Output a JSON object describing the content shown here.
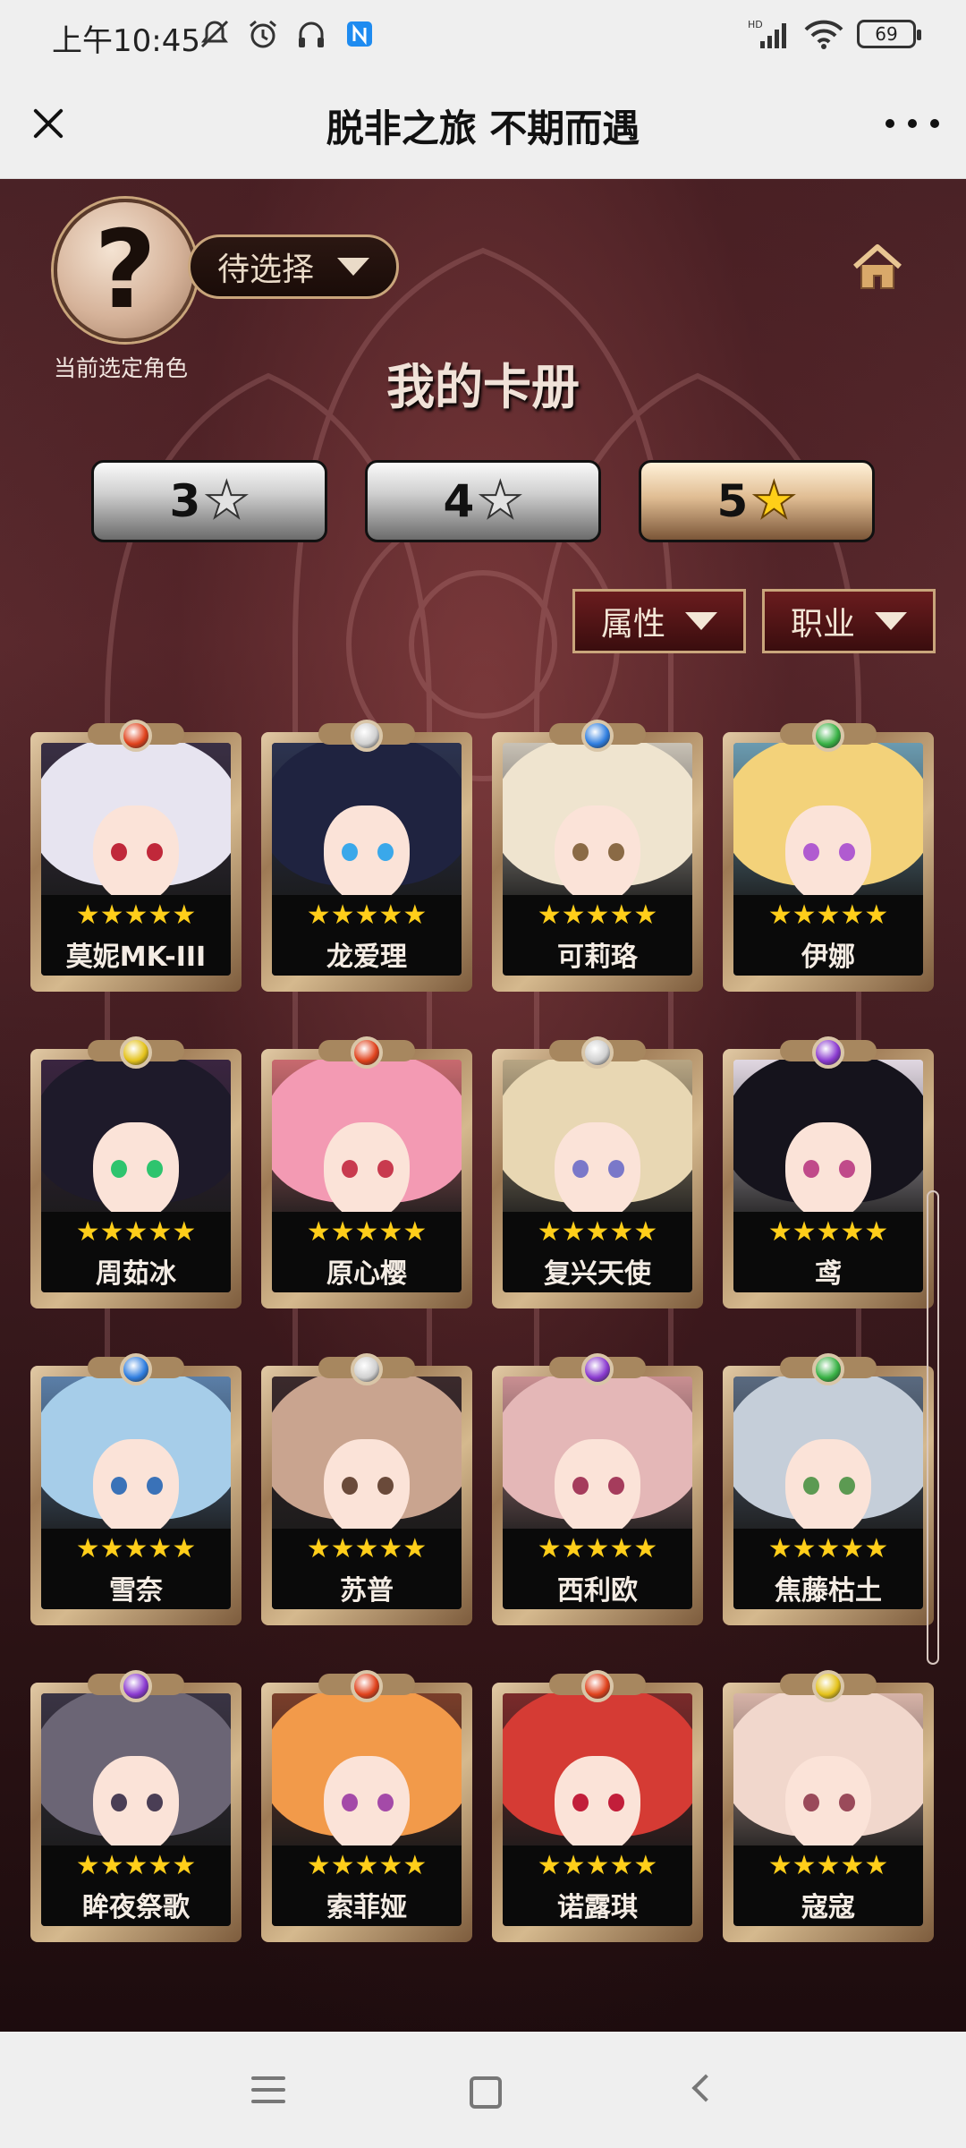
{
  "status_bar": {
    "time": "上午10:45",
    "network_type": "HD",
    "battery_level": "69"
  },
  "title_bar": {
    "title": "脱非之旅 不期而遇"
  },
  "header": {
    "avatar_symbol": "?",
    "role_select_value": "待选择",
    "avatar_caption": "当前选定角色"
  },
  "album_title": "我的卡册",
  "star_tabs": [
    {
      "number": "3",
      "star": "★",
      "selected": false
    },
    {
      "number": "4",
      "star": "★",
      "selected": false
    },
    {
      "number": "5",
      "star": "★",
      "selected": true
    }
  ],
  "filters": {
    "attribute_label": "属性",
    "class_label": "职业"
  },
  "cards": [
    {
      "name": "莫妮MK-III",
      "stars": "★★★★★",
      "element": "fire",
      "hair": "#e7e4f0",
      "eye": "#c0283a",
      "bg": "#3a2f44"
    },
    {
      "name": "龙爱理",
      "stars": "★★★★★",
      "element": "neutral",
      "hair": "#1f2340",
      "eye": "#3aa8ea",
      "bg": "#2c3350"
    },
    {
      "name": "可莉珞",
      "stars": "★★★★★",
      "element": "water",
      "hair": "#efe4cf",
      "eye": "#8a6a45",
      "bg": "#c8c1b5"
    },
    {
      "name": "伊娜",
      "stars": "★★★★★",
      "element": "wind",
      "hair": "#f3d27a",
      "eye": "#b05bd0",
      "bg": "#6b9bb0"
    },
    {
      "name": "周茹冰",
      "stars": "★★★★★",
      "element": "light",
      "hair": "#1e1a2a",
      "eye": "#2ec46e",
      "bg": "#3a2540"
    },
    {
      "name": "原心樱",
      "stars": "★★★★★",
      "element": "fire",
      "hair": "#f39ab3",
      "eye": "#c83a4e",
      "bg": "#c86a6f"
    },
    {
      "name": "复兴天使",
      "stars": "★★★★★",
      "element": "neutral",
      "hair": "#e8d7b3",
      "eye": "#7a78c9",
      "bg": "#b7a583"
    },
    {
      "name": "鸢",
      "stars": "★★★★★",
      "element": "dark",
      "hair": "#15131c",
      "eye": "#c04a8a",
      "bg": "#e1d8e2"
    },
    {
      "name": "雪奈",
      "stars": "★★★★★",
      "element": "water",
      "hair": "#a6cde9",
      "eye": "#3a72b8",
      "bg": "#5b7fa8"
    },
    {
      "name": "苏普",
      "stars": "★★★★★",
      "element": "neutral",
      "hair": "#c9a48f",
      "eye": "#6a4a3a",
      "bg": "#3b2a2c"
    },
    {
      "name": "西利欧",
      "stars": "★★★★★",
      "element": "dark",
      "hair": "#e4b7b7",
      "eye": "#a53c5c",
      "bg": "#c98f92"
    },
    {
      "name": "焦藤枯土",
      "stars": "★★★★★",
      "element": "wind",
      "hair": "#c5ced9",
      "eye": "#5c9a52",
      "bg": "#5a6a80"
    },
    {
      "name": "眸夜祭歌",
      "stars": "★★★★★",
      "element": "dark",
      "hair": "#6b6575",
      "eye": "#4a3e55",
      "bg": "#3a3444"
    },
    {
      "name": "索菲娅",
      "stars": "★★★★★",
      "element": "fire",
      "hair": "#f29a4a",
      "eye": "#a44aa8",
      "bg": "#7a3e2a"
    },
    {
      "name": "诺露琪",
      "stars": "★★★★★",
      "element": "fire",
      "hair": "#d53b34",
      "eye": "#c21e3a",
      "bg": "#7a2a2a"
    },
    {
      "name": "寇寇",
      "stars": "★★★★★",
      "element": "light",
      "hair": "#f1d7cc",
      "eye": "#9a4a5a",
      "bg": "#d7b3a8"
    }
  ],
  "element_colors": {
    "fire": "#e0421c",
    "water": "#2f7ee0",
    "wind": "#38b245",
    "light": "#e4c21a",
    "dark": "#8a3ad0",
    "neutral": "#d0d0d0"
  },
  "colors": {
    "star_gold": "#ffce1a",
    "frame_gold": "#c9a57b"
  }
}
